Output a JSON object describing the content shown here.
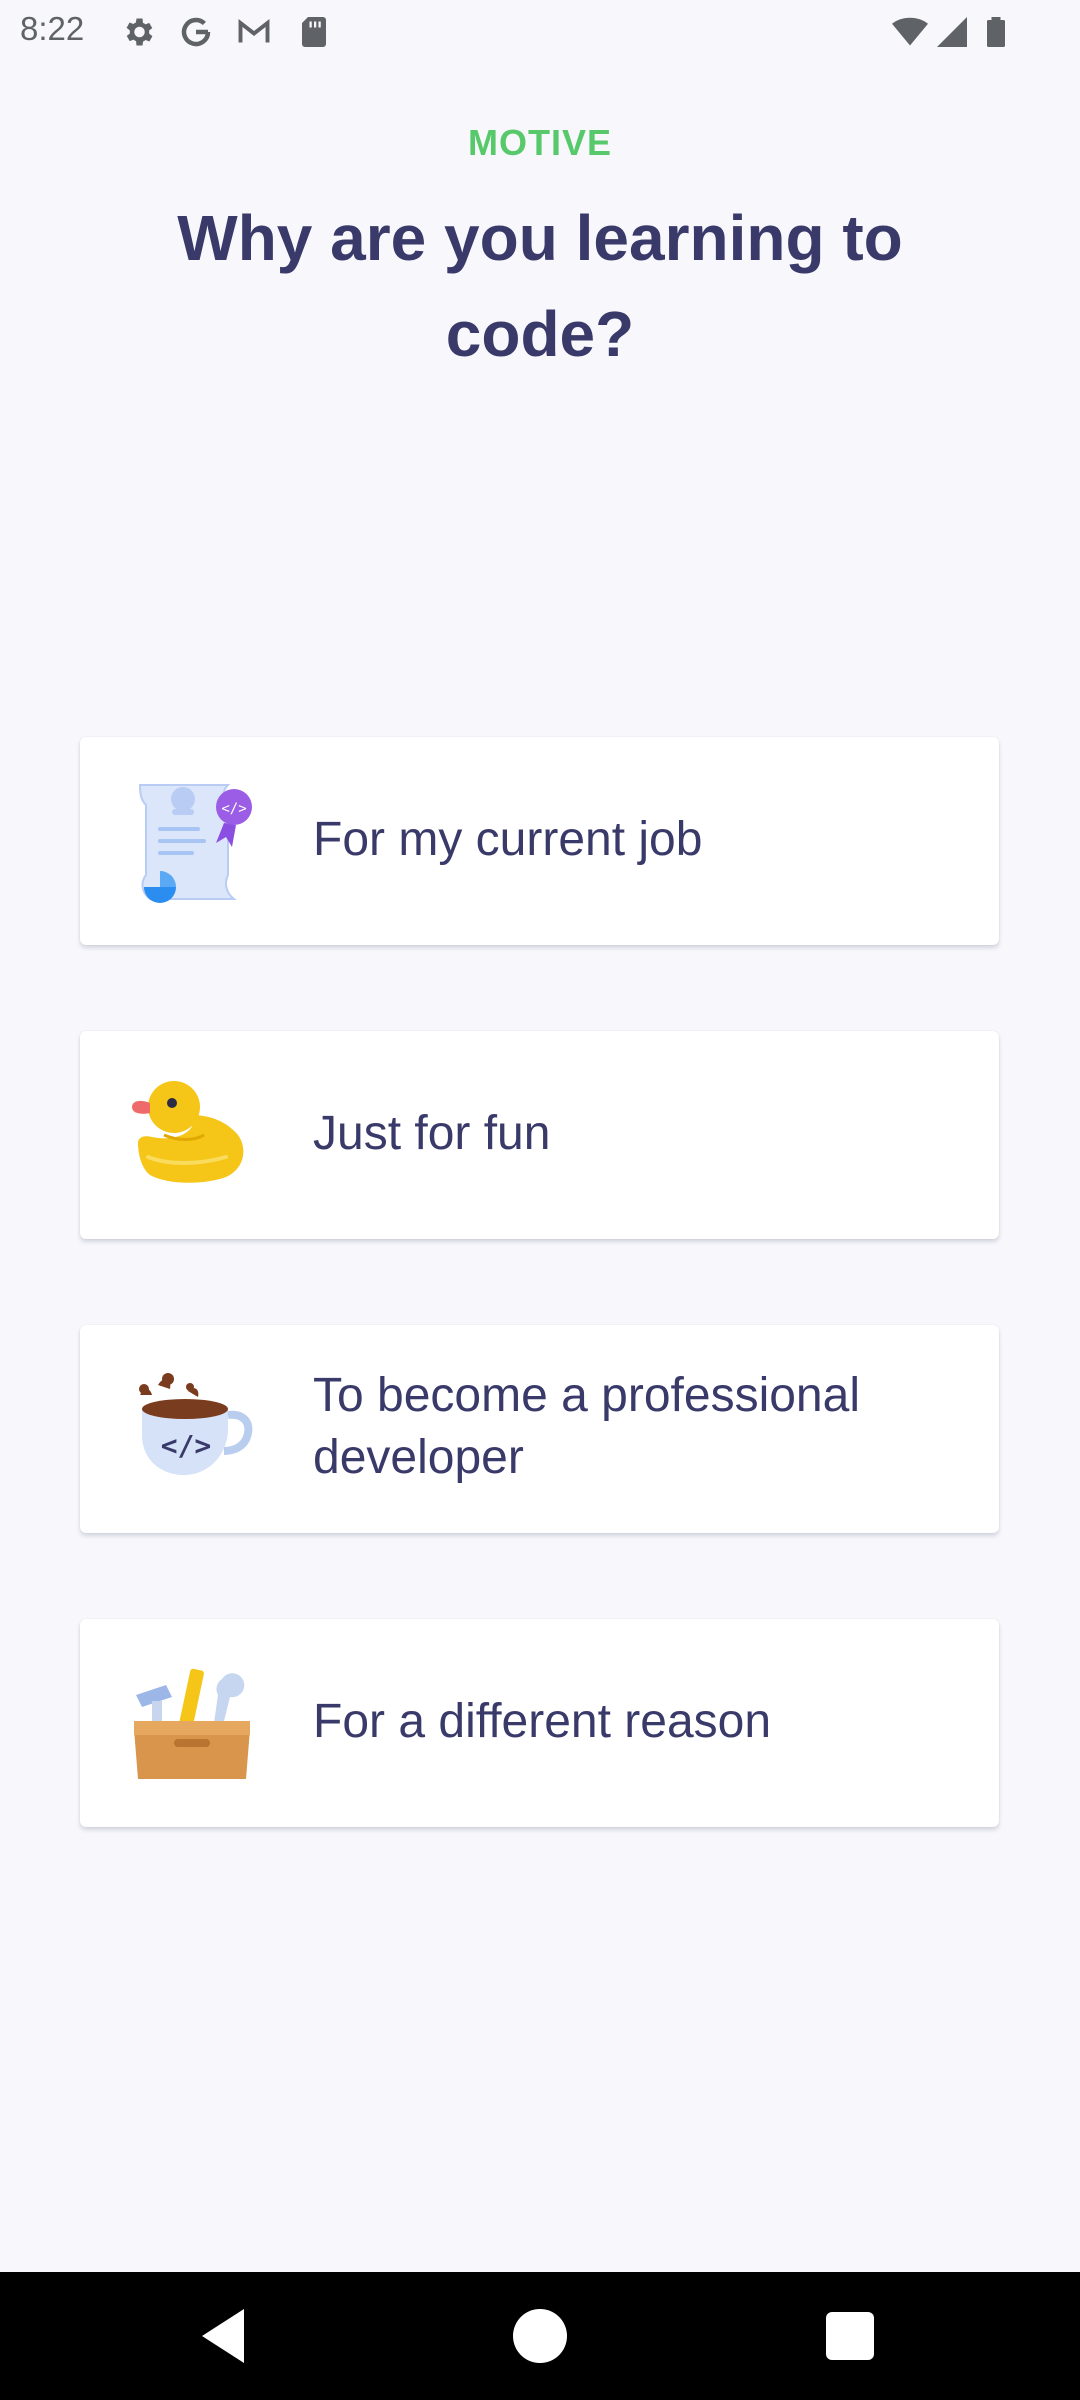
{
  "status_bar": {
    "time": "8:22",
    "left_icons": [
      "settings-icon",
      "google-icon",
      "gmail-icon",
      "sd-card-icon"
    ],
    "right_icons": [
      "wifi-icon",
      "signal-icon",
      "battery-icon"
    ]
  },
  "header": {
    "eyebrow": "MOTIVE",
    "title": "Why are you learning to code?"
  },
  "options": [
    {
      "label": "For my current job",
      "icon": "certificate-icon"
    },
    {
      "label": "Just for fun",
      "icon": "rubber-duck-icon"
    },
    {
      "label": "To become a professional developer",
      "icon": "coffee-mug-icon"
    },
    {
      "label": "For a different reason",
      "icon": "toolbox-icon"
    }
  ],
  "nav_bar": {
    "buttons": [
      "back-icon",
      "home-icon",
      "recents-icon"
    ]
  },
  "colors": {
    "background": "#f7f7fc",
    "accent_green": "#58c96b",
    "text_navy": "#3a3a6a"
  }
}
